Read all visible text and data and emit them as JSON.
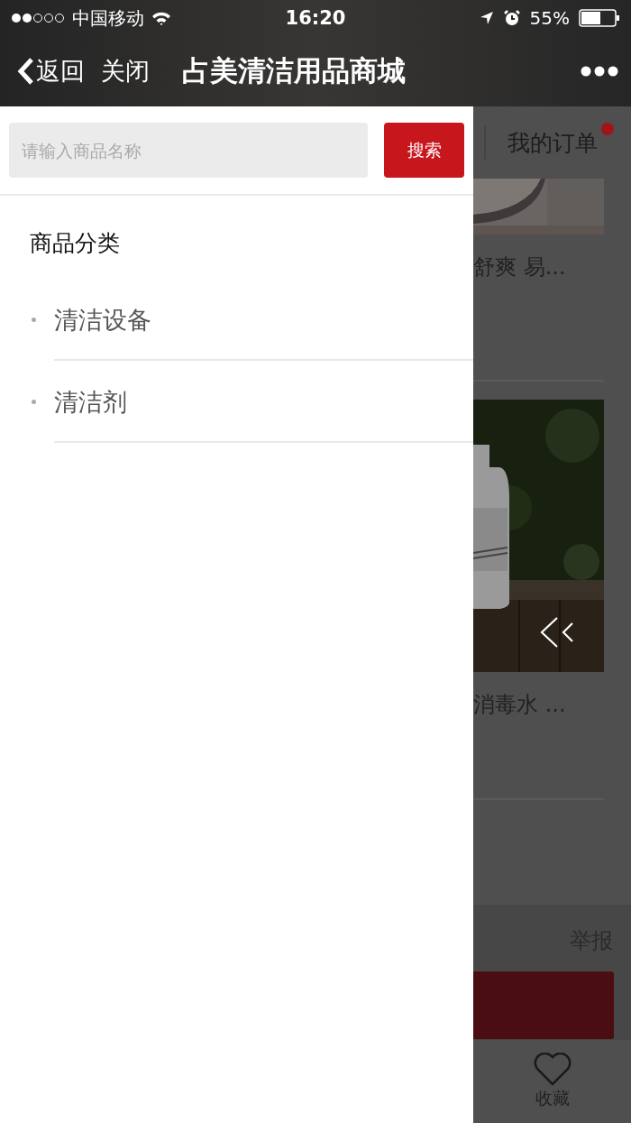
{
  "status_bar": {
    "carrier": "中国移动",
    "time": "16:20",
    "battery": "55%"
  },
  "nav": {
    "back": "返回",
    "close": "关闭",
    "title": "占美清洁用品商城"
  },
  "drawer": {
    "search": {
      "placeholder": "请输入商品名称",
      "button": "搜索"
    },
    "heading": "商品分类",
    "categories": [
      {
        "label": "清洁设备"
      },
      {
        "label": "清洁剂"
      }
    ]
  },
  "background_page": {
    "tab": "我的订单",
    "products": [
      {
        "name": "舒爽 易..."
      },
      {
        "name": "消毒水 ..."
      }
    ],
    "report": "举报",
    "favorite": "收藏"
  }
}
